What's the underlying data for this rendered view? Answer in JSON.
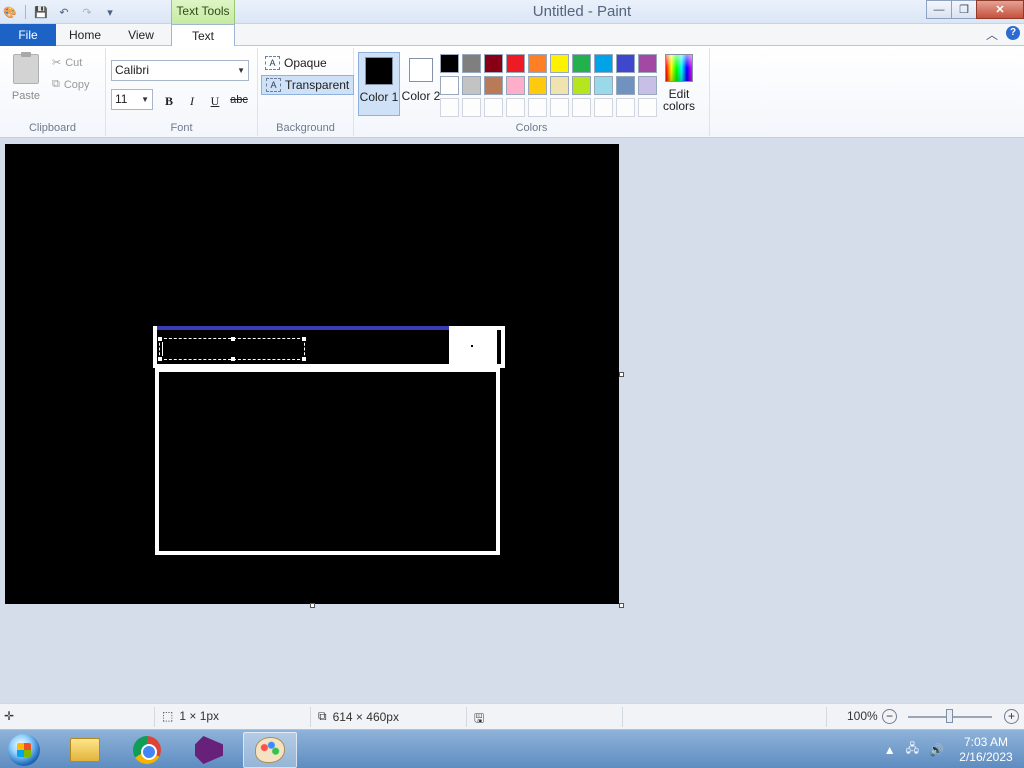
{
  "window": {
    "title": "Untitled - Paint",
    "context_tab": "Text Tools",
    "buttons": {
      "minimize": "—",
      "restore": "❐",
      "close": "✕"
    }
  },
  "tabs": {
    "file": "File",
    "home": "Home",
    "view": "View",
    "text": "Text"
  },
  "ribbon": {
    "clipboard": {
      "paste": "Paste",
      "cut": "Cut",
      "copy": "Copy",
      "label": "Clipboard"
    },
    "font": {
      "family": "Calibri",
      "size": "11",
      "bold": "B",
      "italic": "I",
      "underline": "U",
      "strike": "abc",
      "label": "Font"
    },
    "background": {
      "opaque": "Opaque",
      "transparent": "Transparent",
      "label": "Background"
    },
    "colors": {
      "color1_label": "Color 1",
      "color2_label": "Color 2",
      "color1": "#000000",
      "color2": "#ffffff",
      "edit_colors": "Edit colors",
      "label": "Colors",
      "palette_row1": [
        "#000000",
        "#7f7f7f",
        "#880015",
        "#ed1c24",
        "#ff7f27",
        "#fff200",
        "#22b14c",
        "#00a2e8",
        "#3f48cc",
        "#a349a4"
      ],
      "palette_row2": [
        "#ffffff",
        "#c3c3c3",
        "#b97a57",
        "#ffaec9",
        "#ffc90e",
        "#efe4b0",
        "#b5e61d",
        "#99d9ea",
        "#7092be",
        "#c8bfe7"
      ]
    }
  },
  "status": {
    "selection_size": "1 × 1px",
    "canvas_size": "614 × 460px",
    "zoom": "100%"
  },
  "taskbar": {
    "time": "7:03 AM",
    "date": "2/16/2023"
  }
}
